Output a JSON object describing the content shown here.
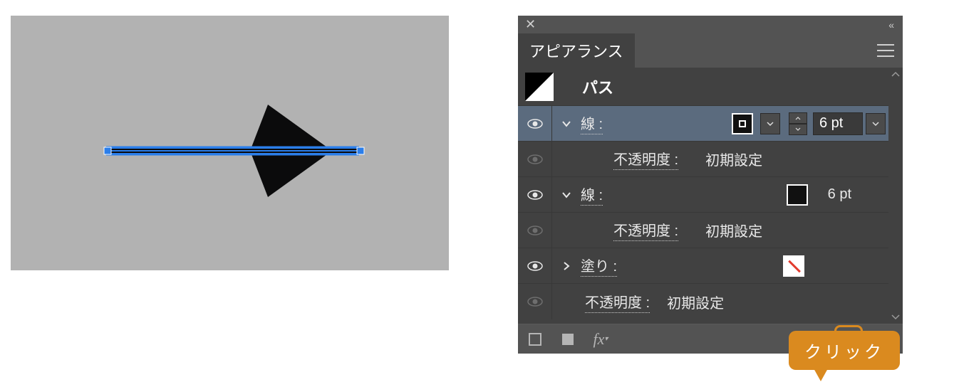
{
  "canvas": {
    "object": "arrow-path"
  },
  "panel": {
    "title": "アピアランス",
    "header_item": "パス",
    "rows": {
      "stroke1": {
        "label": "線 :",
        "size": "6 pt"
      },
      "opacity1": {
        "label": "不透明度 :",
        "value": "初期設定"
      },
      "stroke2": {
        "label": "線 :",
        "size": "6 pt"
      },
      "opacity2": {
        "label": "不透明度 :",
        "value": "初期設定"
      },
      "fill": {
        "label": "塗り :"
      },
      "opacity3": {
        "label": "不透明度 :",
        "value": "初期設定"
      }
    },
    "footer": {
      "fx": "fx"
    }
  },
  "callout": "クリック"
}
